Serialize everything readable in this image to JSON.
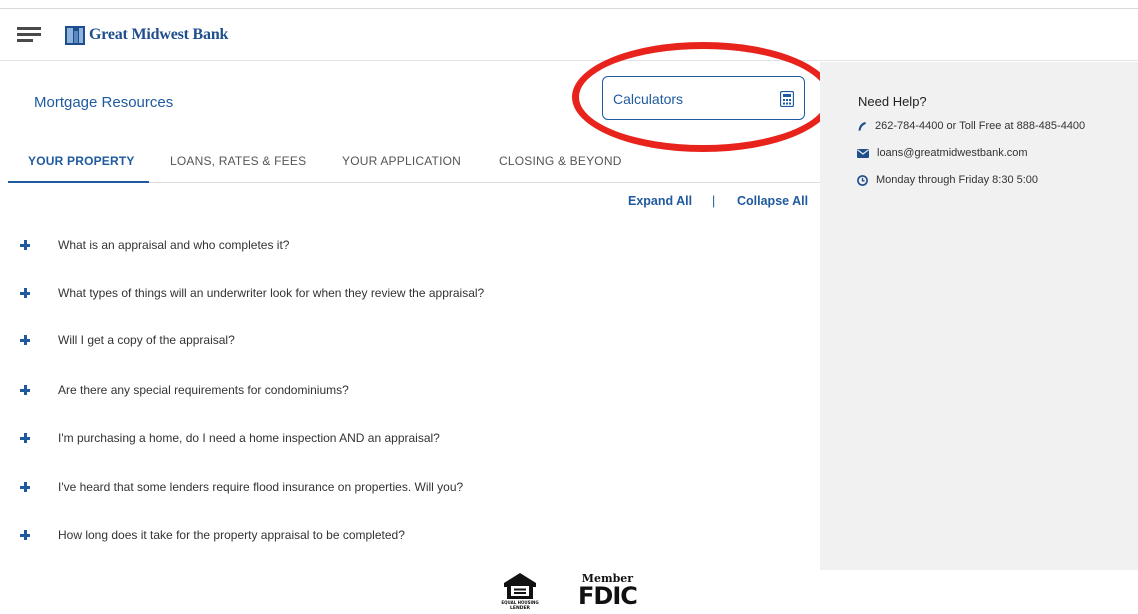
{
  "header": {
    "brand": "Great Midwest Bank"
  },
  "page": {
    "title": "Mortgage Resources",
    "calculators_label": "Calculators"
  },
  "tabs": [
    {
      "label": "YOUR PROPERTY",
      "active": true
    },
    {
      "label": "LOANS, RATES & FEES",
      "active": false
    },
    {
      "label": "YOUR APPLICATION",
      "active": false
    },
    {
      "label": "CLOSING & BEYOND",
      "active": false
    }
  ],
  "controls": {
    "expand_all": "Expand All",
    "separator": "|",
    "collapse_all": "Collapse All"
  },
  "faqs": [
    "What is an appraisal and who completes it?",
    "What types of things will an underwriter look for when they review the appraisal?",
    "Will I get a copy of the appraisal?",
    "Are there any special requirements for condominiums?",
    "I'm purchasing a home, do I need a home inspection AND an appraisal?",
    "I've heard that some lenders require flood insurance on properties. Will you?",
    "How long does it take for the property appraisal to be completed?"
  ],
  "help": {
    "title": "Need Help?",
    "phone": "262-784-4400 or Toll Free at 888-485-4400",
    "email": "loans@greatmidwestbank.com",
    "hours": "Monday through Friday 8:30 5:00"
  },
  "footer": {
    "ehl_text": "EQUAL HOUSING LENDER",
    "fdic_member": "Member",
    "fdic_text": "FDIC"
  },
  "colors": {
    "brand_blue": "#1f5a9e",
    "highlight_red": "#e8231c",
    "sidebar_bg": "#f1f1f1"
  },
  "icons": {
    "menu": "hamburger-menu-icon",
    "calculator": "calculator-icon",
    "phone": "phone-icon",
    "email": "envelope-icon",
    "hours": "clock-icon",
    "expand": "plus-icon"
  }
}
